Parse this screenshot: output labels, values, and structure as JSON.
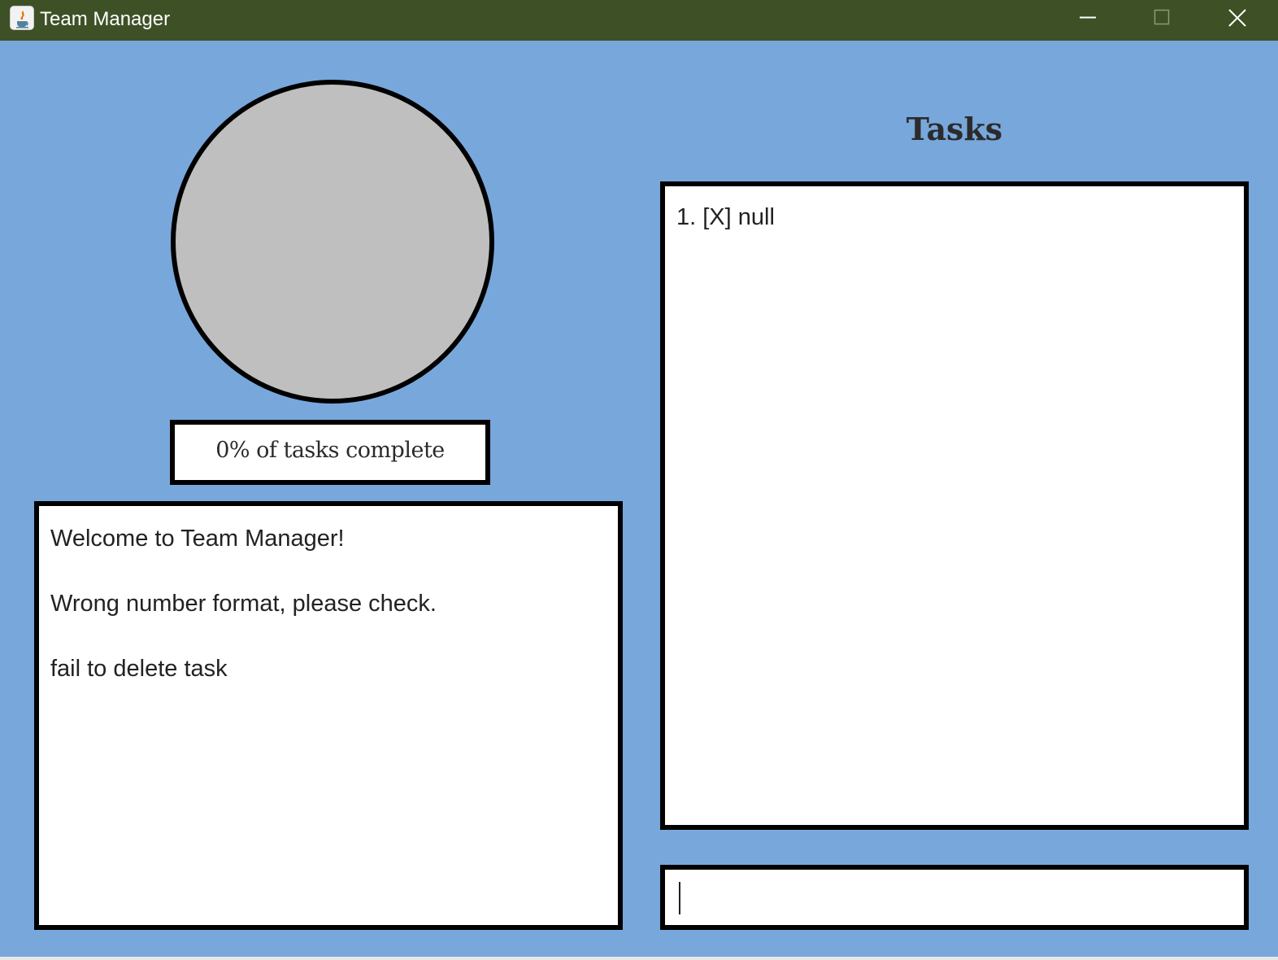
{
  "window": {
    "title": "Team Manager",
    "icon": "java-cup-icon",
    "controls": [
      "minimize-icon",
      "maximize-icon",
      "close-icon"
    ],
    "titlebar_color": "#3e5126"
  },
  "progress": {
    "complete_fraction": 0,
    "label": "0% of tasks complete"
  },
  "log": {
    "messages": [
      "Welcome to Team Manager!",
      "Wrong number format, please check.",
      "fail to delete task"
    ]
  },
  "tasks": {
    "heading": "Tasks",
    "items": [
      "1. [X] null"
    ]
  },
  "command": {
    "value": "",
    "placeholder": ""
  },
  "colors": {
    "background": "#78a7db",
    "panel": "#ffffff",
    "border": "#000000",
    "progress_empty": "#bfbfbf"
  }
}
